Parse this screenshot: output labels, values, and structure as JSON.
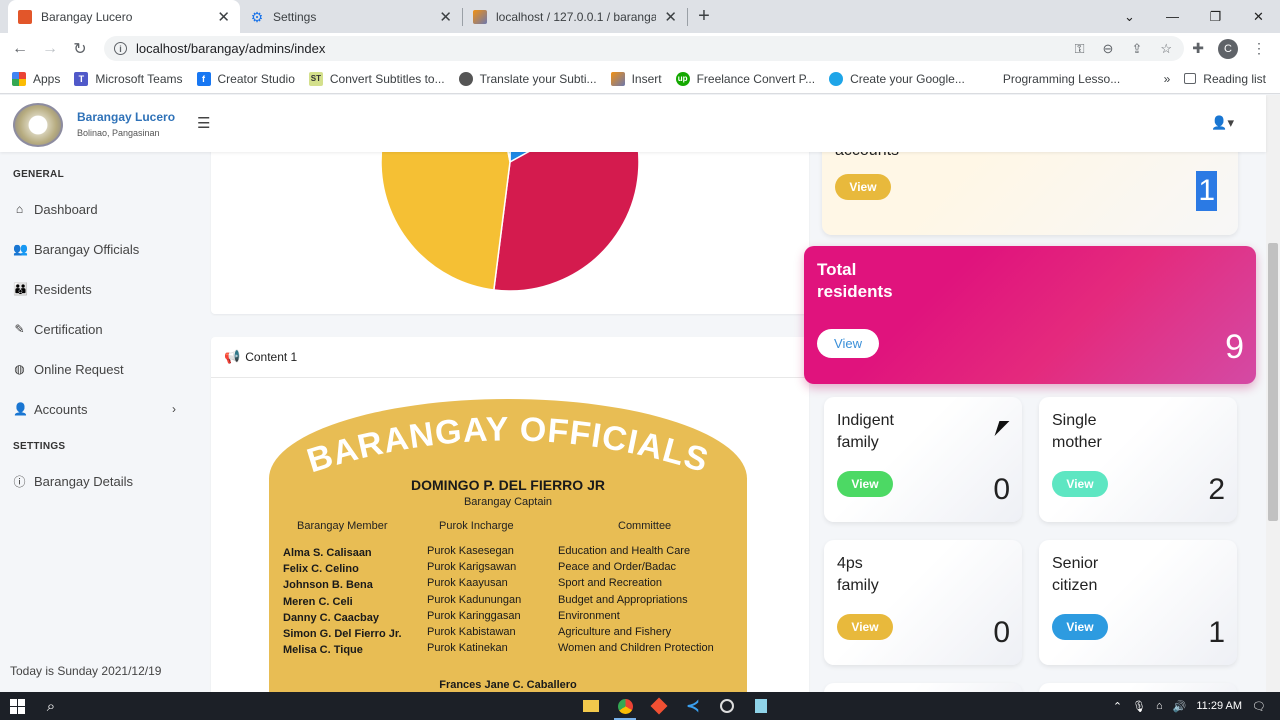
{
  "browser": {
    "tabs": [
      {
        "title": "Barangay Lucero",
        "active": true
      },
      {
        "title": "Settings",
        "active": false
      },
      {
        "title": "localhost / 127.0.0.1 / barangay_",
        "active": false
      }
    ],
    "url": "localhost/barangay/admins/index",
    "profile_initial": "C",
    "bookmarks": [
      "Apps",
      "Microsoft Teams",
      "Creator Studio",
      "Convert Subtitles to...",
      "Translate your Subti...",
      "Insert",
      "Freelance Convert P...",
      "Create your Google...",
      "Programming Lesso..."
    ],
    "reading_list": "Reading list"
  },
  "header": {
    "brand_name": "Barangay Lucero",
    "brand_sub": "Bolinao, Pangasinan"
  },
  "sidebar": {
    "general_heading": "GENERAL",
    "items": [
      {
        "label": "Dashboard",
        "icon": "home-icon"
      },
      {
        "label": "Barangay Officials",
        "icon": "user-group-icon"
      },
      {
        "label": "Residents",
        "icon": "users-icon"
      },
      {
        "label": "Certification",
        "icon": "certificate-icon"
      },
      {
        "label": "Online Request",
        "icon": "globe-icon"
      },
      {
        "label": "Accounts",
        "icon": "user-gear-icon"
      }
    ],
    "settings_heading": "SETTINGS",
    "settings_items": [
      {
        "label": "Barangay Details",
        "icon": "info-icon"
      }
    ],
    "today": "Today is Sunday 2021/12/19"
  },
  "content": {
    "title": "Content 1",
    "poster": {
      "title": "BARANGAY OFFICIALS",
      "captain": "DOMINGO P. DEL FIERRO JR",
      "captain_role": "Barangay Captain",
      "col_member": "Barangay Member",
      "col_purok": "Purok Incharge",
      "col_committee": "Committee",
      "members": [
        "Alma S. Calisaan",
        "Felix C. Celino",
        "Johnson B. Bena",
        "Meren C. Celi",
        "Danny C. Caacbay",
        "Simon G. Del Fierro Jr.",
        "Melisa C. Tique"
      ],
      "puroks": [
        "Purok Kasesegan",
        "Purok Karigsawan",
        "Purok Kaayusan",
        "Purok Kadunungan",
        "Purok Karinggasan",
        "Purok Kabistawan",
        "Purok Katinekan"
      ],
      "committees": [
        "Education and Health Care",
        "Peace and Order/Badac",
        "Sport and Recreation",
        "Budget and Appropriations",
        "Environment",
        "Agriculture and Fishery",
        "Women and Children Protection"
      ],
      "secretary": "Frances Jane C. Caballero"
    }
  },
  "pie": {
    "slices": [
      {
        "value": 17,
        "color": "#1e88e5"
      },
      {
        "value": 35,
        "color": "#d41b4e"
      },
      {
        "value": 45,
        "color": "#f5c034"
      },
      {
        "value": 3,
        "color": "#5bc95b"
      }
    ]
  },
  "stats": {
    "accounts": {
      "label": "accounts",
      "button": "View",
      "value": "1",
      "button_color": "#e8b93c"
    },
    "residents": {
      "label_line1": "Total",
      "label_line2": "residents",
      "button": "View",
      "value": "9"
    },
    "indigent": {
      "label_line1": "Indigent",
      "label_line2": "family",
      "button": "View",
      "value": "0",
      "button_color": "#4cd964"
    },
    "single_mother": {
      "label_line1": "Single",
      "label_line2": "mother",
      "button": "View",
      "value": "2",
      "button_color": "#5ee6c2"
    },
    "fourps": {
      "label_line1": "4ps",
      "label_line2": "family",
      "button": "View",
      "value": "0",
      "button_color": "#e8b93c"
    },
    "senior": {
      "label_line1": "Senior",
      "label_line2": "citizen",
      "button": "View",
      "value": "1",
      "button_color": "#2d9be0"
    }
  },
  "taskbar": {
    "time": "11:29 AM"
  }
}
